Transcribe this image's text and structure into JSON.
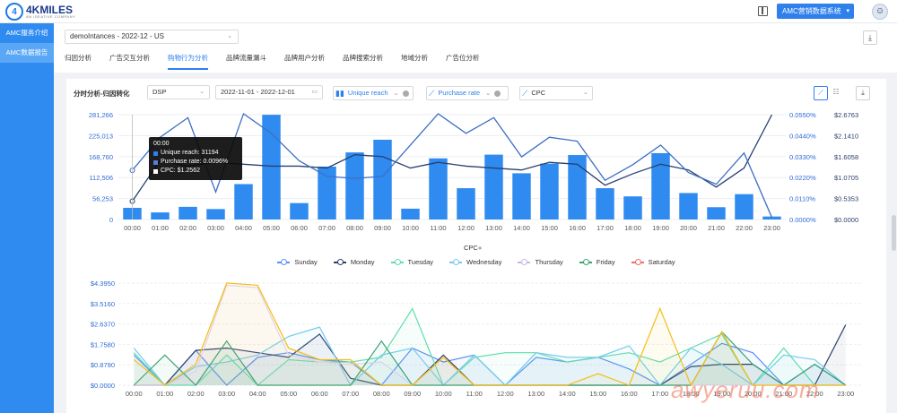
{
  "brand": {
    "name": "4KMILES",
    "sub": "AN IDEATIVE COMPANY",
    "accent": "#2f8bf0"
  },
  "topbar": {
    "system_select": "AMC营销数据系统",
    "avatar_icon": "user-avatar-icon",
    "panel_icon": "panel-toggle-icon"
  },
  "sidebar": {
    "items": [
      {
        "label": "AMC服务介绍"
      },
      {
        "label": "AMC数据报告"
      }
    ]
  },
  "header": {
    "account_select": "demoIntances - 2022-12 - US",
    "tabs": [
      {
        "label": "归因分析"
      },
      {
        "label": "广告交互分析"
      },
      {
        "label": "购物行为分析"
      },
      {
        "label": "品牌流量漏斗"
      },
      {
        "label": "品牌用户分析"
      },
      {
        "label": "品牌搜索分析"
      },
      {
        "label": "地域分析"
      },
      {
        "label": "广告位分析"
      }
    ],
    "active_tab": "购物行为分析"
  },
  "filters": {
    "label": "分时分析-归因转化",
    "channel": "DSP",
    "date_range": "2022-11-01 - 2022-12-01",
    "metric1": "Unique reach",
    "metric2": "Purchase rate",
    "metric3": "CPC"
  },
  "tooltip": {
    "time": "00:00",
    "rows": [
      {
        "label": "Unique reach:",
        "value": "31194",
        "color": "#2f80ed"
      },
      {
        "label": "Purchase rate:",
        "value": "0.0096%",
        "color": "#2e4a8a"
      },
      {
        "label": "CPC:",
        "value": "$1.2562",
        "color": "#ffffff"
      }
    ]
  },
  "chart_data": [
    {
      "type": "bar",
      "categories": [
        "00:00",
        "01:00",
        "02:00",
        "03:00",
        "04:00",
        "05:00",
        "06:00",
        "07:00",
        "08:00",
        "09:00",
        "10:00",
        "11:00",
        "12:00",
        "13:00",
        "14:00",
        "15:00",
        "16:00",
        "17:00",
        "18:00",
        "19:00",
        "20:00",
        "21:00",
        "22:00",
        "23:00"
      ],
      "y_ticks": [
        "0",
        "56,253",
        "112,506",
        "168,760",
        "225,013",
        "281,266"
      ],
      "y2_ticks": [
        "0.0000%",
        "0.0110%",
        "0.0220%",
        "0.0330%",
        "0.0440%",
        "0.0550%"
      ],
      "y3_ticks": [
        "$0.0000",
        "$0.5353",
        "$1.0705",
        "$1.6058",
        "$2.1410",
        "$2.6763"
      ],
      "ylim": [
        0,
        281266
      ],
      "series": [
        {
          "name": "Unique reach",
          "kind": "bar",
          "color": "#2f8bf0",
          "values": [
            31194,
            19000,
            34000,
            28000,
            95000,
            281000,
            44000,
            142000,
            180000,
            214000,
            29000,
            164000,
            84000,
            174000,
            124000,
            150000,
            173000,
            84000,
            62000,
            178000,
            71000,
            33000,
            68000,
            8000
          ]
        },
        {
          "name": "Purchase rate",
          "kind": "line",
          "color": "#27416e",
          "ylim": [
            0,
            0.055
          ],
          "values": [
            0.0096,
            0.031,
            0.028,
            0.03,
            0.029,
            0.028,
            0.028,
            0.027,
            0.034,
            0.033,
            0.027,
            0.03,
            0.028,
            0.027,
            0.026,
            0.03,
            0.029,
            0.018,
            0.024,
            0.029,
            0.026,
            0.017,
            0.027,
            0.055
          ]
        },
        {
          "name": "CPC",
          "kind": "line",
          "color": "#3d6fc4",
          "ylim": [
            0,
            2.6763
          ],
          "values": [
            1.2562,
            2.1,
            2.6,
            0.7,
            2.7,
            2.2,
            1.5,
            1.1,
            1.05,
            1.1,
            1.9,
            2.7,
            2.2,
            2.6,
            1.6,
            2.1,
            2.0,
            1.0,
            1.4,
            1.9,
            1.2,
            0.9,
            1.7,
            0.05
          ]
        }
      ]
    },
    {
      "type": "line",
      "title": "CPC",
      "categories": [
        "00:00",
        "01:00",
        "02:00",
        "03:00",
        "04:00",
        "05:00",
        "06:00",
        "07:00",
        "08:00",
        "09:00",
        "10:00",
        "11:00",
        "12:00",
        "13:00",
        "14:00",
        "15:00",
        "16:00",
        "17:00",
        "18:00",
        "19:00",
        "20:00",
        "21:00",
        "22:00",
        "23:00"
      ],
      "y_ticks": [
        "$0.0000",
        "$0.8790",
        "$1.7580",
        "$2.6370",
        "$3.5160",
        "$4.3950"
      ],
      "ylim": [
        0,
        4.395
      ],
      "legend": "top-center",
      "series": [
        {
          "name": "Sunday",
          "color": "#5b8ff9",
          "values": [
            1.3,
            0.0,
            1.5,
            0.0,
            1.2,
            1.4,
            1.1,
            1.0,
            0.0,
            1.6,
            1.0,
            1.3,
            0.0,
            1.2,
            1.0,
            1.2,
            0.7,
            0.0,
            0.9,
            1.8,
            1.4,
            0.0,
            0.9,
            0.0
          ]
        },
        {
          "name": "Monday",
          "color": "#2d3e6a",
          "values": [
            0.0,
            0.0,
            1.5,
            1.6,
            1.4,
            1.2,
            2.2,
            0.3,
            0.0,
            0.0,
            1.3,
            0.0,
            0.0,
            0.0,
            0.0,
            0.0,
            0.0,
            0.0,
            0.8,
            0.9,
            0.9,
            0.0,
            0.0,
            2.6
          ]
        },
        {
          "name": "Tuesday",
          "color": "#61ddaa",
          "values": [
            1.4,
            0.0,
            0.0,
            1.3,
            0.0,
            1.1,
            1.0,
            1.0,
            1.2,
            3.3,
            0.0,
            1.2,
            1.4,
            1.4,
            1.0,
            1.2,
            1.4,
            1.0,
            1.6,
            2.2,
            0.0,
            1.6,
            0.0,
            0.0
          ]
        },
        {
          "name": "Wednesday",
          "color": "#74cbed",
          "values": [
            1.6,
            0.0,
            0.8,
            1.0,
            1.3,
            2.1,
            2.5,
            0.0,
            1.3,
            1.6,
            0.0,
            1.3,
            0.0,
            1.4,
            1.2,
            1.2,
            1.7,
            0.0,
            1.6,
            0.9,
            0.0,
            1.3,
            1.1,
            0.0
          ]
        },
        {
          "name": "Thursday",
          "color": "#e1d4f0",
          "values": [
            0.0,
            0.0,
            0.6,
            4.3,
            4.2,
            1.3,
            1.0,
            0.9,
            1.0,
            0.0,
            0.0,
            0.0,
            0.0,
            0.0,
            0.0,
            0.0,
            0.0,
            0.0,
            0.0,
            0.0,
            0.0,
            0.0,
            0.0,
            0.0
          ]
        },
        {
          "name": "Friday",
          "color": "#3ba272",
          "values": [
            0.0,
            1.3,
            0.0,
            1.9,
            0.0,
            0.0,
            0.0,
            0.0,
            1.9,
            0.0,
            0.0,
            0.0,
            0.0,
            0.0,
            0.0,
            0.0,
            0.0,
            0.0,
            0.0,
            2.3,
            0.9,
            0.0,
            0.9,
            0.0
          ]
        },
        {
          "name": "Saturday",
          "color": "#f6bd16",
          "values": [
            1.1,
            0.0,
            0.9,
            4.4,
            4.3,
            1.6,
            1.1,
            1.1,
            0.0,
            0.0,
            1.2,
            0.0,
            0.0,
            0.0,
            0.0,
            0.5,
            0.0,
            3.3,
            0.0,
            2.3,
            0.0,
            0.0,
            0.0,
            0.0
          ]
        }
      ]
    }
  ],
  "watermark": "awyeruu.com"
}
